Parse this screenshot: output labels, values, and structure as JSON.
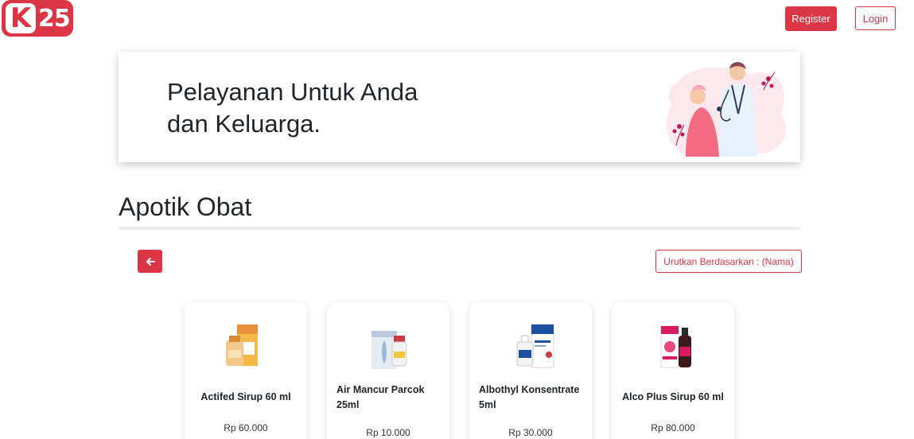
{
  "brand": {
    "logo_letter": "K",
    "logo_number": "25"
  },
  "nav": {
    "register_label": "Register",
    "login_label": "Login"
  },
  "hero": {
    "title_line1": "Pelayanan Untuk Anda",
    "title_line2": "dan Keluarga."
  },
  "section": {
    "title": "Apotik Obat",
    "sort_label": "Urutkan Berdasarkan : (Nama)"
  },
  "products": [
    {
      "name": "Actifed Sirup 60 ml",
      "price": "Rp 60.000"
    },
    {
      "name": "Air Mancur Parcok 25ml",
      "price": "Rp 10.000"
    },
    {
      "name": "Albothyl Konsentrate 5ml",
      "price": "Rp 30.000"
    },
    {
      "name": "Alco Plus Sirup 60 ml",
      "price": "Rp 80.000"
    }
  ],
  "colors": {
    "primary": "#dc3545",
    "text": "#212529"
  },
  "icons": {
    "back": "arrow-left-icon"
  }
}
